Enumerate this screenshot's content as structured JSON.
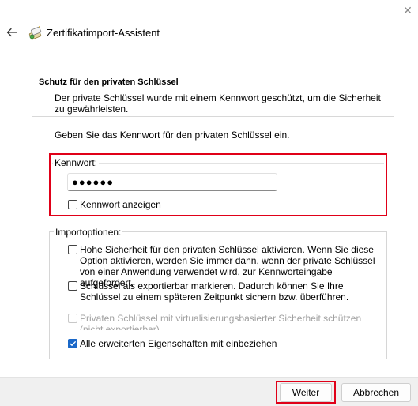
{
  "window": {
    "title": "Zertifikatimport-Assistent",
    "close_glyph": "✕"
  },
  "page": {
    "section_title": "Schutz für den privaten Schlüssel",
    "description": "Der private Schlüssel wurde mit einem Kennwort geschützt, um die Sicherheit zu gewährleisten.",
    "prompt": "Geben Sie das Kennwort für den privaten Schlüssel ein."
  },
  "password": {
    "label": "Kennwort:",
    "value": "●●●●●●",
    "show_label": "Kennwort anzeigen",
    "show_checked": false
  },
  "import_options": {
    "label": "Importoptionen:",
    "options": [
      {
        "label": "Hohe Sicherheit für den privaten Schlüssel aktivieren. Wenn Sie diese Option aktivieren, werden Sie immer dann, wenn der private Schlüssel von einer Anwendung verwendet wird, zur Kennworteingabe aufgefordert.",
        "checked": false,
        "enabled": true
      },
      {
        "label": "Schlüssel als exportierbar markieren. Dadurch können Sie Ihre Schlüssel zu einem späteren Zeitpunkt sichern bzw. überführen.",
        "checked": false,
        "enabled": true
      },
      {
        "label": "Privaten Schlüssel mit virtualisierungsbasierter Sicherheit schützen (nicht exportierbar)",
        "checked": false,
        "enabled": false
      },
      {
        "label": "Alle erweiterten Eigenschaften mit einbeziehen",
        "checked": true,
        "enabled": true
      }
    ]
  },
  "footer": {
    "next_label": "Weiter",
    "cancel_label": "Abbrechen"
  },
  "colors": {
    "highlight": "#e00018",
    "accent": "#1a68c8"
  },
  "icons": {
    "back": "back-arrow-icon",
    "app": "certificate-wizard-icon",
    "close": "close-icon",
    "check": "checkmark-icon"
  }
}
